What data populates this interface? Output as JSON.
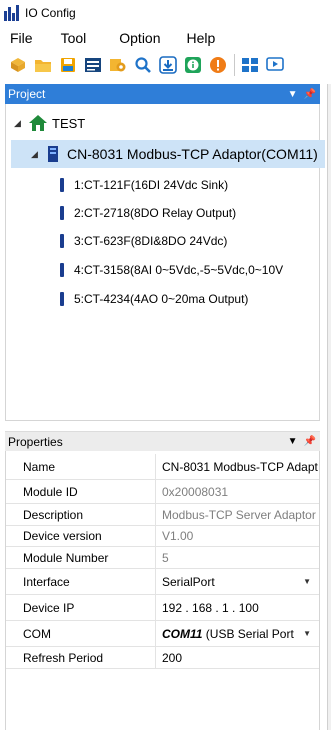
{
  "window": {
    "title": "IO Config"
  },
  "menu": [
    "File",
    "Tool",
    "Option",
    "Help"
  ],
  "toolbar": {
    "icons": [
      "new-icon",
      "open-folder-icon",
      "save-icon",
      "config-icon",
      "settings-icon",
      "search-icon",
      "download-icon",
      "info-icon",
      "alert-icon",
      "layout-icon",
      "media-icon"
    ]
  },
  "project": {
    "title": "Project",
    "pin": "📌",
    "root": "TEST",
    "adaptor": "CN-8031 Modbus-TCP Adaptor(COM11)",
    "modules": [
      "1:CT-121F(16DI 24Vdc Sink)",
      "2:CT-2718(8DO Relay Output)",
      "3:CT-623F(8DI&8DO 24Vdc)",
      "4:CT-3158(8AI 0~5Vdc,-5~5Vdc,0~10V",
      "5:CT-4234(4AO 0~20ma Output)"
    ]
  },
  "properties": {
    "title": "Properties",
    "rows": [
      {
        "name": "Name",
        "value": "CN-8031 Modbus-TCP Adapt",
        "style": "normal"
      },
      {
        "name": "Module ID",
        "value": "0x20008031",
        "style": "muted"
      },
      {
        "name": "Description",
        "value": "Modbus-TCP Server Adaptor",
        "style": "muted"
      },
      {
        "name": "Device version",
        "value": "V1.00",
        "style": "muted"
      },
      {
        "name": "Module Number",
        "value": "5",
        "style": "muted"
      },
      {
        "name": "Interface",
        "value": "SerialPort",
        "style": "dropdown"
      },
      {
        "name": "Device IP",
        "value": "192 . 168 .  1  . 100",
        "style": "normal"
      },
      {
        "name": "COM",
        "value_bold": "COM11",
        "value": " (USB Serial Port",
        "style": "dropdown-bold"
      },
      {
        "name": "Refresh Period",
        "value": "200",
        "style": "normal"
      }
    ]
  },
  "colors": {
    "project_header": "#2f7ed8",
    "selected_row": "#cde3f7",
    "module_icon": "#1a3d8f",
    "home_icon": "#1f8a3a"
  }
}
